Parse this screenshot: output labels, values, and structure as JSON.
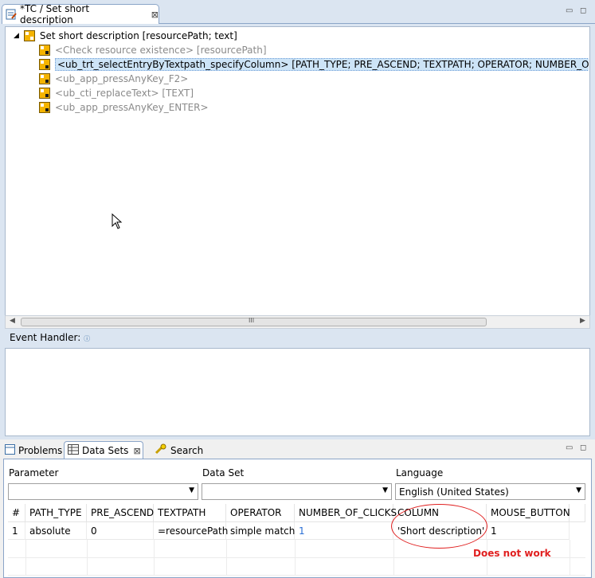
{
  "editor": {
    "tab_title": "*TC / Set short description",
    "tree": {
      "root": "Set short description [resourcePath; text]",
      "children": [
        {
          "label": "<Check resource existence> [resourcePath]"
        },
        {
          "label": "<ub_trt_selectEntryByTextpath_specifyColumn> [PATH_TYPE; PRE_ASCEND; TEXTPATH; OPERATOR; NUMBER_OF_CLICKS; CO"
        },
        {
          "label": "<ub_app_pressAnyKey_F2>"
        },
        {
          "label": "<ub_cti_replaceText> [TEXT]"
        },
        {
          "label": "<ub_app_pressAnyKey_ENTER>"
        }
      ]
    },
    "event_handler_label": "Event Handler:",
    "scroll_grip": "III"
  },
  "bottom": {
    "tabs": [
      {
        "label": "Problems"
      },
      {
        "label": "Data Sets"
      },
      {
        "label": "Search"
      }
    ],
    "parameter_label": "Parameter",
    "parameter_value": "",
    "dataset_label": "Data Set",
    "dataset_value": "",
    "language_label": "Language",
    "language_value": "English (United States)",
    "table": {
      "headers": [
        "#",
        "PATH_TYPE",
        "PRE_ASCEND",
        "TEXTPATH",
        "OPERATOR",
        "NUMBER_OF_CLICKS",
        "COLUMN",
        "MOUSE_BUTTON"
      ],
      "rows": [
        [
          "1",
          "absolute",
          "0",
          "=resourcePath",
          "simple match",
          "1",
          "'Short description'",
          "1"
        ]
      ]
    },
    "annotation": "Does not work"
  },
  "colors": {
    "accent": "#8ba5c8",
    "selection": "#cde4f7",
    "annotation": "#e02020",
    "link_value": "#2a6fd6"
  }
}
